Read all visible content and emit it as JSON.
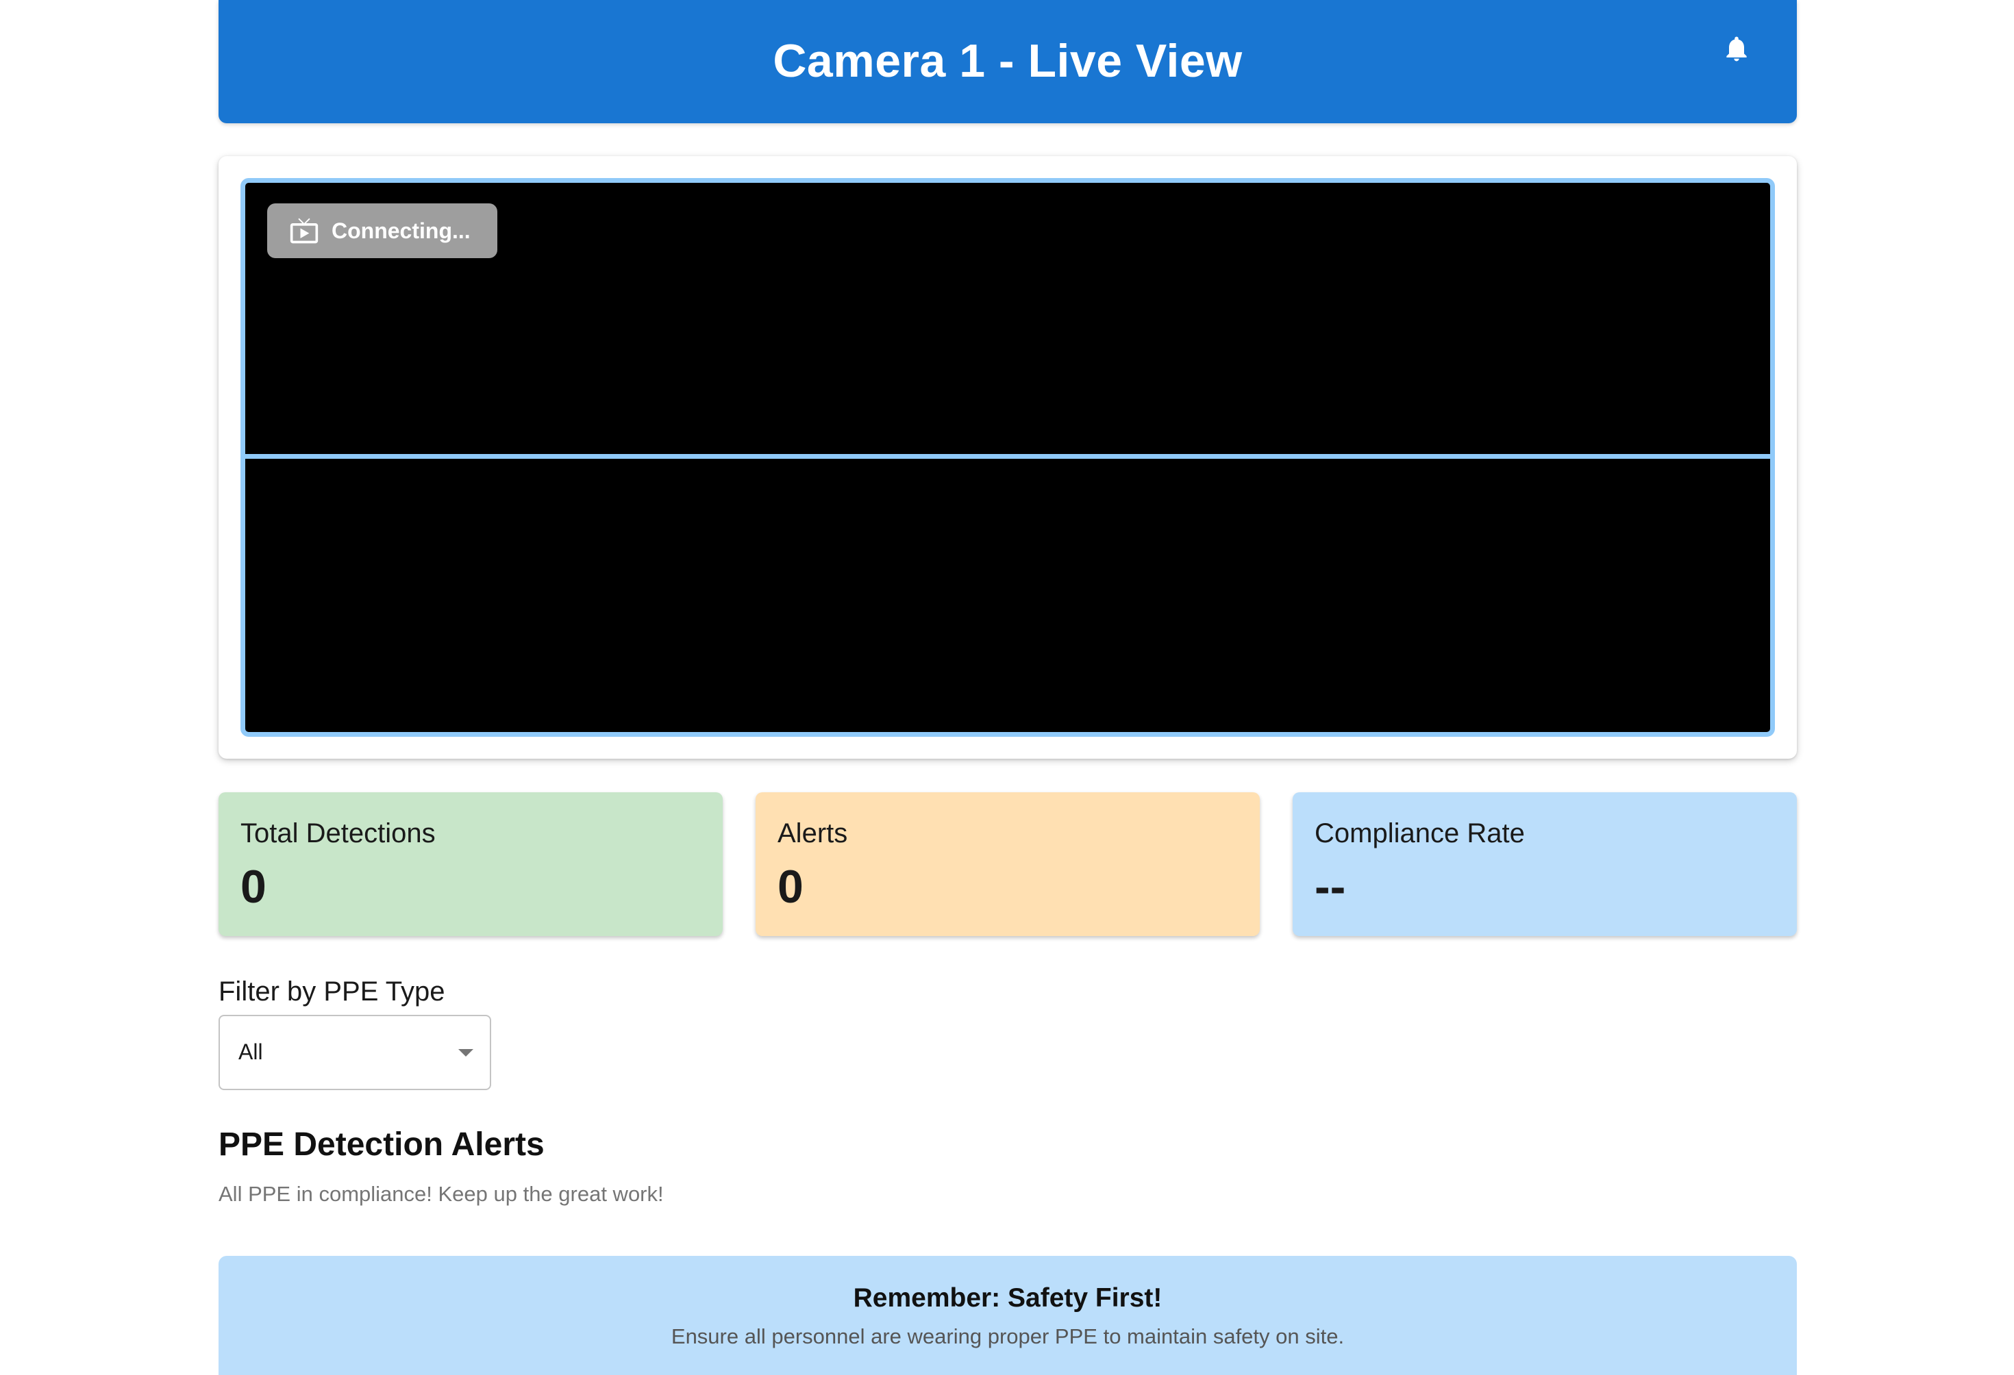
{
  "header": {
    "title": "Camera 1 - Live View",
    "notification_icon": "bell-icon"
  },
  "video": {
    "status_icon": "live-tv-icon",
    "status_text": "Connecting..."
  },
  "stats": [
    {
      "label": "Total Detections",
      "value": "0",
      "color": "#c8e6c9"
    },
    {
      "label": "Alerts",
      "value": "0",
      "color": "#ffe0b2"
    },
    {
      "label": "Compliance Rate",
      "value": "--",
      "color": "#bbdefb"
    }
  ],
  "filter": {
    "label": "Filter by PPE Type",
    "selected": "All"
  },
  "alerts": {
    "heading": "PPE Detection Alerts",
    "message": "All PPE in compliance! Keep up the great work!"
  },
  "banner": {
    "title": "Remember: Safety First!",
    "subtitle": "Ensure all personnel are wearing proper PPE to maintain safety on site."
  },
  "colors": {
    "header_bg": "#1976d2",
    "video_border": "#90caf9"
  }
}
